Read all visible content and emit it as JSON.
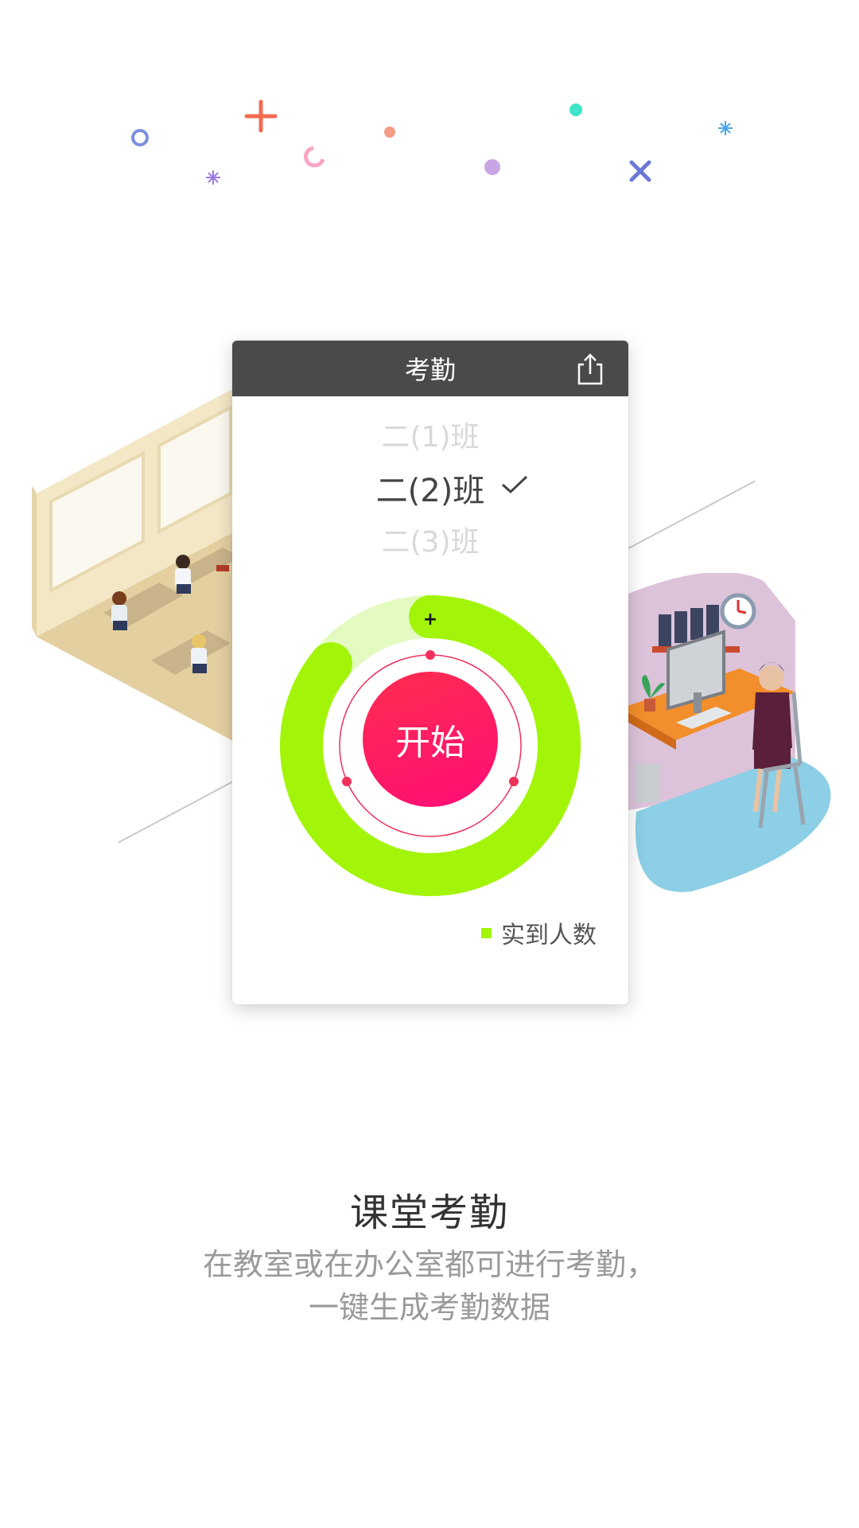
{
  "card": {
    "title": "考勤",
    "share_icon": "share-icon",
    "class_picker": {
      "prev": "二(1)班",
      "selected": "二(2)班",
      "next": "二(3)班",
      "check_icon": "check-icon"
    },
    "start_label": "开始",
    "ring_plus": "+",
    "legend_label": "实到人数"
  },
  "headline": "课堂考勤",
  "subtext": {
    "line1": "在教室或在办公室都可进行考勤，",
    "line2": "一键生成考勤数据"
  },
  "colors": {
    "header_bg": "#4a4a4a",
    "ring_green": "#a2f508",
    "ring_light": "#e3fbc1",
    "start_pink": "#ff1464",
    "accent_red": "#f0305c"
  }
}
